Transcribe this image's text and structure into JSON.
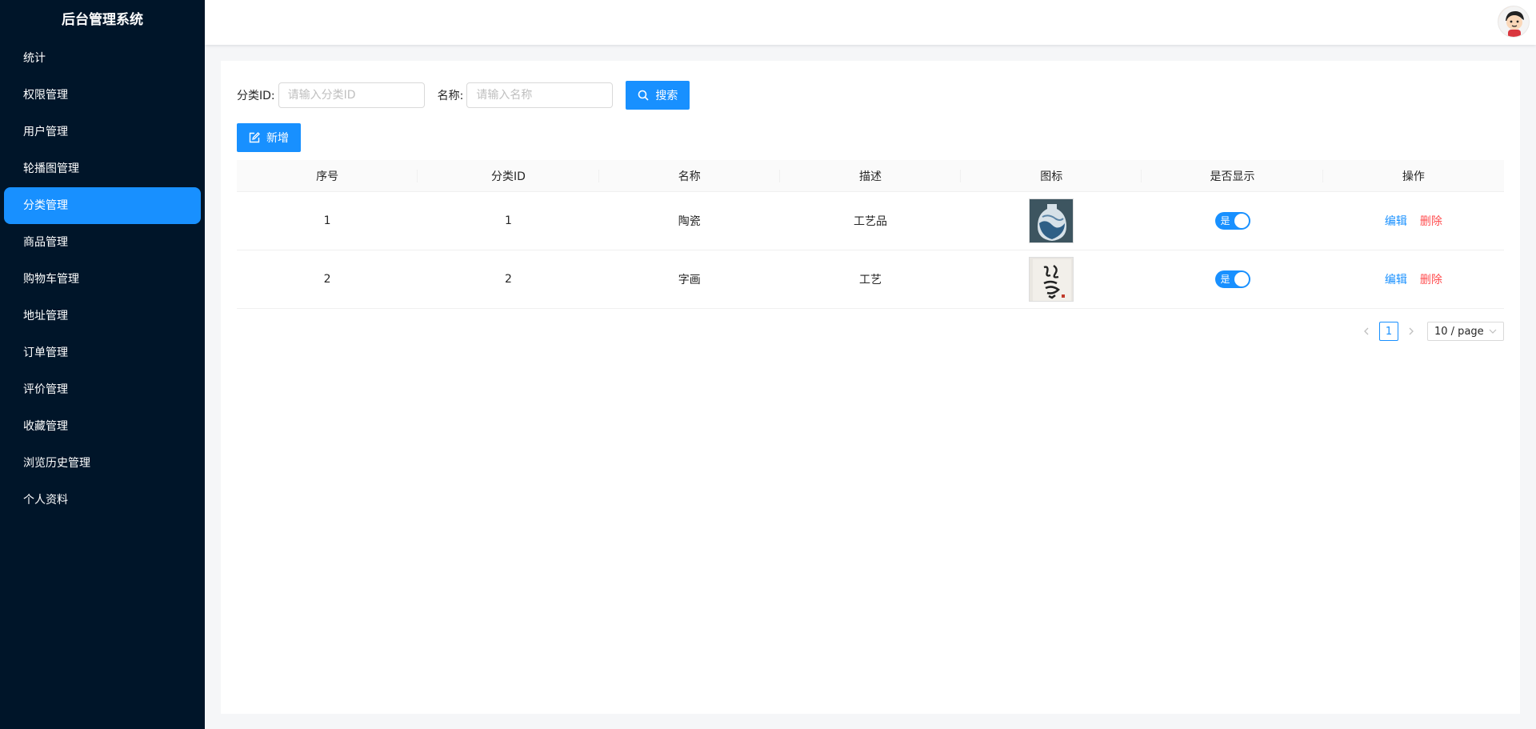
{
  "app": {
    "title": "后台管理系统"
  },
  "sidebar": {
    "items": [
      {
        "label": "统计"
      },
      {
        "label": "权限管理"
      },
      {
        "label": "用户管理"
      },
      {
        "label": "轮播图管理"
      },
      {
        "label": "分类管理",
        "active": true
      },
      {
        "label": "商品管理"
      },
      {
        "label": "购物车管理"
      },
      {
        "label": "地址管理"
      },
      {
        "label": "订单管理"
      },
      {
        "label": "评价管理"
      },
      {
        "label": "收藏管理"
      },
      {
        "label": "浏览历史管理"
      },
      {
        "label": "个人资料"
      }
    ]
  },
  "search": {
    "category_id_label": "分类ID:",
    "category_id_placeholder": "请输入分类ID",
    "name_label": "名称:",
    "name_placeholder": "请输入名称",
    "search_button": "搜索",
    "search_icon": "search-icon"
  },
  "toolbar": {
    "add_button": "新增",
    "add_icon": "edit-icon"
  },
  "table": {
    "columns": [
      "序号",
      "分类ID",
      "名称",
      "描述",
      "图标",
      "是否显示",
      "操作"
    ],
    "rows": [
      {
        "index": "1",
        "category_id": "1",
        "name": "陶瓷",
        "description": "工艺品",
        "icon": "porcelain-vase-image",
        "show_label": "是",
        "show": true,
        "edit": "编辑",
        "delete": "删除"
      },
      {
        "index": "2",
        "category_id": "2",
        "name": "字画",
        "description": "工艺",
        "icon": "calligraphy-image",
        "show_label": "是",
        "show": true,
        "edit": "编辑",
        "delete": "删除"
      }
    ]
  },
  "pagination": {
    "prev_icon": "chevron-left-icon",
    "current": "1",
    "next_icon": "chevron-right-icon",
    "page_size": "10 / page"
  },
  "colors": {
    "sidebar_bg": "#001529",
    "primary": "#1890ff",
    "danger": "#ff4d4f"
  }
}
